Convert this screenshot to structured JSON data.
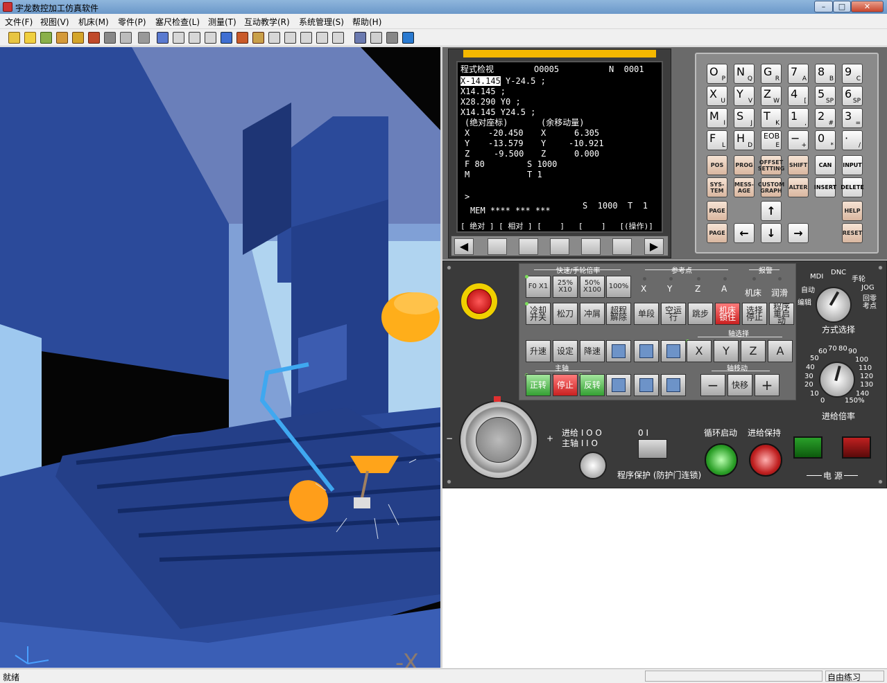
{
  "window": {
    "title": "宇龙数控加工仿真软件",
    "min": "–",
    "max": "□",
    "close": "✕"
  },
  "menu": [
    "文件(F)",
    "视图(V)",
    "机床(M)",
    "零件(P)",
    "塞尺检查(L)",
    "测量(T)",
    "互动教学(R)",
    "系统管理(S)",
    "帮助(H)"
  ],
  "colors": {
    "accent": "#f5b800",
    "crt_bg": "#000000",
    "panel_bg": "#3a3a3a",
    "machine_blue": "#2b4a9a"
  },
  "crt": {
    "header_mode": "程式检视",
    "header_prog": "O0005",
    "header_n": "N  0001",
    "line1_hl": "X-14.145",
    "line1_rest": " Y-24.5 ;",
    "line2": "X14.145 ;",
    "line3": "X28.290 Y0 ;",
    "line4": "X14.145 Y24.5 ;",
    "abs_title": "(绝对座标)",
    "rem_title": "(余移动量)",
    "abs": [
      {
        "axis": "X",
        "value": "-20.450"
      },
      {
        "axis": "Y",
        "value": "-13.579"
      },
      {
        "axis": "Z",
        "value": "-9.500"
      }
    ],
    "rem": [
      {
        "axis": "X",
        "value": "6.305"
      },
      {
        "axis": "Y",
        "value": "-10.921"
      },
      {
        "axis": "Z",
        "value": "0.000"
      }
    ],
    "feed": "F 80",
    "spindle": "S 1000",
    "m": "M",
    "tool": "T 1",
    "prompt": ">",
    "mem": "MEM **** *** ***",
    "status_right": "S  1000  T  1",
    "softkey_labels": "[ 绝对 ] [ 相对 ] [    ]   [    ]   [(操作)]"
  },
  "softkeys": {
    "left": "◀",
    "right": "▶"
  },
  "keyboard": {
    "keys": [
      {
        "big": "O",
        "sm": "P"
      },
      {
        "big": "N",
        "sm": "Q"
      },
      {
        "big": "G",
        "sm": "R"
      },
      {
        "big": "7",
        "sm": "A"
      },
      {
        "big": "8",
        "sm": "B"
      },
      {
        "big": "9",
        "sm": "C"
      },
      {
        "big": "X",
        "sm": "U"
      },
      {
        "big": "Y",
        "sm": "V"
      },
      {
        "big": "Z",
        "sm": "W"
      },
      {
        "big": "4",
        "sm": "["
      },
      {
        "big": "5",
        "sm": "SP"
      },
      {
        "big": "6",
        "sm": "SP"
      },
      {
        "big": "M",
        "sm": "I"
      },
      {
        "big": "S",
        "sm": "J"
      },
      {
        "big": "T",
        "sm": "K"
      },
      {
        "big": "1",
        "sm": ","
      },
      {
        "big": "2",
        "sm": "#"
      },
      {
        "big": "3",
        "sm": "="
      },
      {
        "big": "F",
        "sm": "L"
      },
      {
        "big": "H",
        "sm": "D"
      },
      {
        "big": "EOB",
        "sm": "E"
      },
      {
        "big": "−",
        "sm": "+"
      },
      {
        "big": "0",
        "sm": "*"
      },
      {
        "big": "·",
        "sm": "/"
      }
    ],
    "func_keys": [
      "POS",
      "PROG",
      "OFFSET SETTING",
      "SHIFT",
      "CAN",
      "INPUT",
      "SYS- TEM",
      "MESS- AGE",
      "CUSTOM GRAPH",
      "ALTER",
      "INSERT",
      "DELETE"
    ],
    "page_up": "PAGE",
    "page_down": "PAGE",
    "arrow_up": "↑",
    "arrow_down": "↓",
    "arrow_left": "←",
    "arrow_right": "→",
    "help": "HELP",
    "reset": "RESET"
  },
  "panel": {
    "rapid_title": "快速/手轮倍率",
    "rapid_btns": [
      "F0 X1",
      "25% X10",
      "50% X100",
      "100%"
    ],
    "ref_title": "参考点",
    "ref_axes": [
      "X",
      "Y",
      "Z",
      "A"
    ],
    "alarm_title": "报警",
    "alarm_items": [
      "机床",
      "润滑"
    ],
    "row2": [
      "冷却 开关",
      "松刀",
      "冲屑",
      "超程 解除",
      "单段",
      "空运行",
      "跳步",
      "机床 锁住",
      "选择 停止",
      "程序 重启动"
    ],
    "row3": [
      "升速",
      "设定",
      "降速"
    ],
    "axis_select_title": "轴选择",
    "axis_select": [
      "X",
      "Y",
      "Z",
      "A"
    ],
    "spindle_title": "主轴",
    "spindle_btns": [
      "正转",
      "停止",
      "反转"
    ],
    "axis_move_title": "轴移动",
    "axis_move": [
      "−",
      "快移",
      "+"
    ],
    "mode_labels": [
      "编辑",
      "自动",
      "MDI",
      "DNC",
      "手轮",
      "JOG",
      "回零 考点"
    ],
    "mode_title": "方式选择",
    "feed_scale": [
      "0",
      "10",
      "20",
      "30",
      "40",
      "50",
      "60",
      "70",
      "80",
      "90",
      "100",
      "110",
      "120",
      "130",
      "140",
      "150%"
    ],
    "feed_title": "进给倍率",
    "feed_io": "进给 I O O",
    "spindle_io": "主轴 I I O",
    "prog_protect": "程序保护 (防护门连锁)",
    "prog_protect_scale": "0      I",
    "cycle_start": "循环启动",
    "feed_hold": "进给保持",
    "power": "电  源",
    "hw_plus": "+",
    "hw_minus": "−"
  },
  "status": {
    "left": "就绪",
    "right": "自由练习"
  }
}
